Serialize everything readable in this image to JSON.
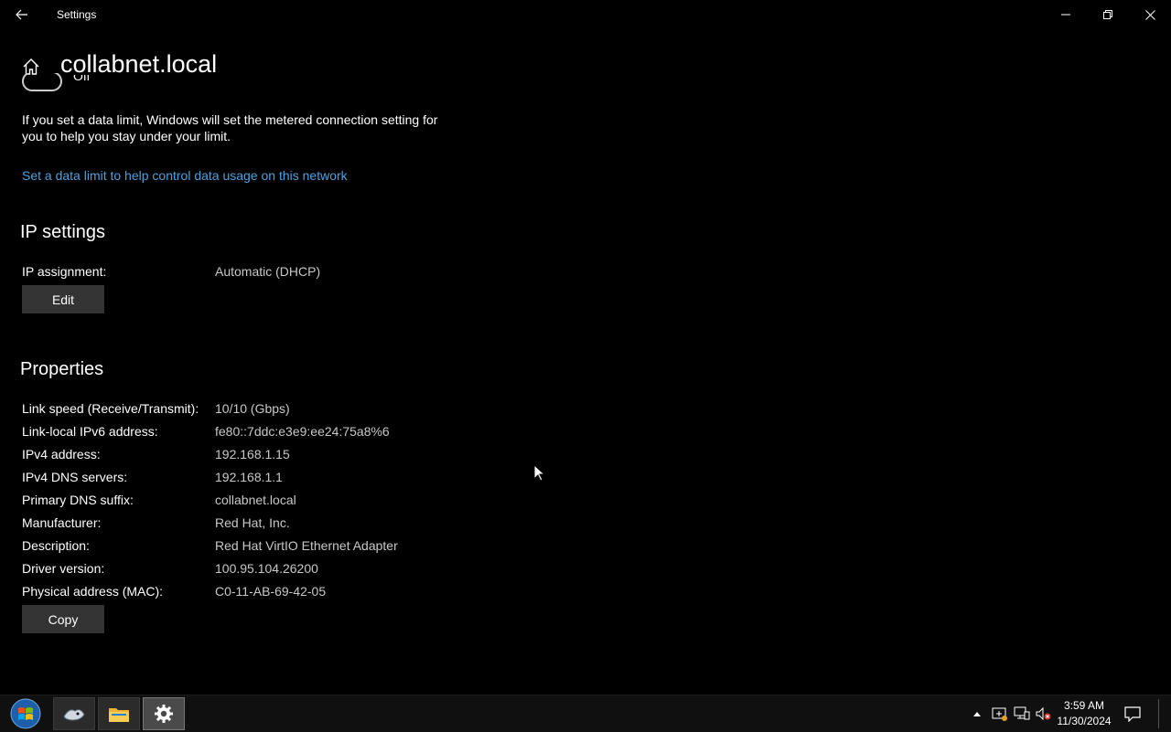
{
  "window": {
    "title": "Settings"
  },
  "header": {
    "title": "collabnet.local"
  },
  "metered": {
    "toggle_state": "Off",
    "info_text": "If you set a data limit, Windows will set the metered connection setting for you to help you stay under your limit.",
    "data_limit_link": "Set a data limit to help control data usage on this network"
  },
  "ip_settings": {
    "heading": "IP settings",
    "assignment_label": "IP assignment:",
    "assignment_value": "Automatic (DHCP)",
    "edit_label": "Edit"
  },
  "properties": {
    "heading": "Properties",
    "rows": [
      {
        "label": "Link speed (Receive/Transmit):",
        "value": "10/10 (Gbps)"
      },
      {
        "label": "Link-local IPv6 address:",
        "value": "fe80::7ddc:e3e9:ee24:75a8%6"
      },
      {
        "label": "IPv4 address:",
        "value": "192.168.1.15"
      },
      {
        "label": "IPv4 DNS servers:",
        "value": "192.168.1.1"
      },
      {
        "label": "Primary DNS suffix:",
        "value": "collabnet.local"
      },
      {
        "label": "Manufacturer:",
        "value": "Red Hat, Inc."
      },
      {
        "label": "Description:",
        "value": "Red Hat VirtIO Ethernet Adapter"
      },
      {
        "label": "Driver version:",
        "value": "100.95.104.26200"
      },
      {
        "label": "Physical address (MAC):",
        "value": "C0-11-AB-69-42-05"
      }
    ],
    "copy_label": "Copy"
  },
  "taskbar": {
    "clock_time": "3:59 AM",
    "clock_date": "11/30/2024",
    "pinned": [
      "terminal-app-icon",
      "file-explorer-icon",
      "settings-gear-icon"
    ],
    "tray": [
      "show-hidden-icons-icon",
      "security-alert-icon",
      "network-icon",
      "volume-muted-icon"
    ]
  },
  "colors": {
    "background": "#000000",
    "link": "#4ca0e0",
    "button": "#333333",
    "value_text": "#c8c8c8"
  }
}
